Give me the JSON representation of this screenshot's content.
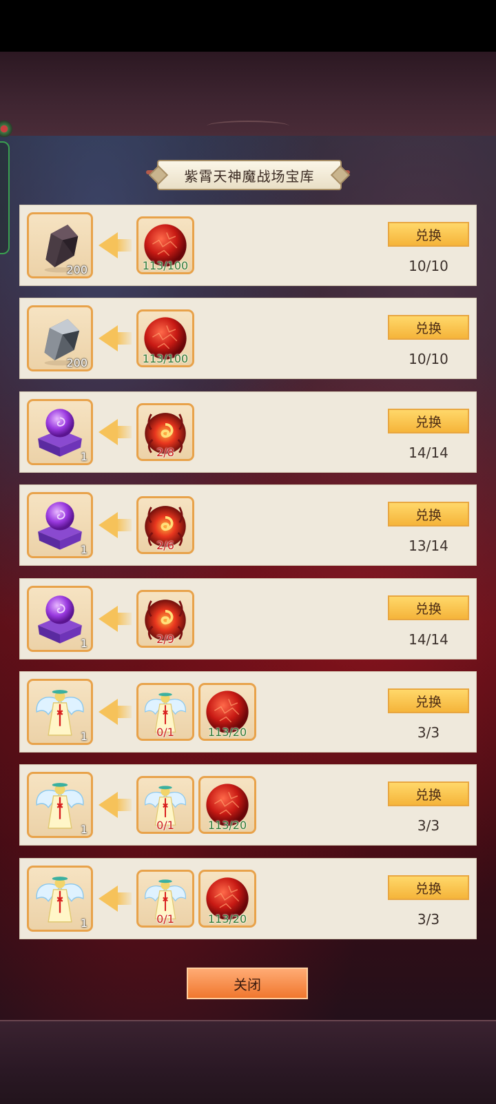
{
  "title": "紫霄天神魔战场宝库",
  "close_label": "关闭",
  "rows": [
    {
      "reward": {
        "icon": "dark-ore-icon",
        "qty": "200"
      },
      "costs": [
        {
          "icon": "red-orb-icon",
          "progress": "113/100",
          "status": "ok"
        }
      ],
      "button": "兑换",
      "count": "10/10"
    },
    {
      "reward": {
        "icon": "silver-ore-icon",
        "qty": "200"
      },
      "costs": [
        {
          "icon": "red-orb-icon",
          "progress": "113/100",
          "status": "ok"
        }
      ],
      "button": "兑换",
      "count": "10/10"
    },
    {
      "reward": {
        "icon": "purple-crystal-ball-icon",
        "qty": "1"
      },
      "costs": [
        {
          "icon": "fire-seal-icon",
          "progress": "2/8",
          "status": "bad"
        }
      ],
      "button": "兑换",
      "count": "14/14"
    },
    {
      "reward": {
        "icon": "purple-crystal-ball-icon",
        "qty": "1"
      },
      "costs": [
        {
          "icon": "fire-seal-icon",
          "progress": "2/6",
          "status": "bad"
        }
      ],
      "button": "兑换",
      "count": "13/14"
    },
    {
      "reward": {
        "icon": "purple-crystal-ball-icon",
        "qty": "1"
      },
      "costs": [
        {
          "icon": "fire-seal-icon",
          "progress": "2/9",
          "status": "bad"
        }
      ],
      "button": "兑换",
      "count": "14/14"
    },
    {
      "reward": {
        "icon": "winged-costume-icon",
        "qty": "1"
      },
      "costs": [
        {
          "icon": "winged-costume-icon",
          "progress": "0/1",
          "status": "bad"
        },
        {
          "icon": "red-orb-icon",
          "progress": "113/20",
          "status": "ok"
        }
      ],
      "button": "兑换",
      "count": "3/3"
    },
    {
      "reward": {
        "icon": "winged-costume-icon",
        "qty": "1"
      },
      "costs": [
        {
          "icon": "winged-costume-icon",
          "progress": "0/1",
          "status": "bad"
        },
        {
          "icon": "red-orb-icon",
          "progress": "113/20",
          "status": "ok"
        }
      ],
      "button": "兑换",
      "count": "3/3"
    },
    {
      "reward": {
        "icon": "winged-costume-icon",
        "qty": "1"
      },
      "costs": [
        {
          "icon": "winged-costume-icon",
          "progress": "0/1",
          "status": "bad"
        },
        {
          "icon": "red-orb-icon",
          "progress": "113/20",
          "status": "ok"
        }
      ],
      "button": "兑换",
      "count": "3/3"
    }
  ]
}
